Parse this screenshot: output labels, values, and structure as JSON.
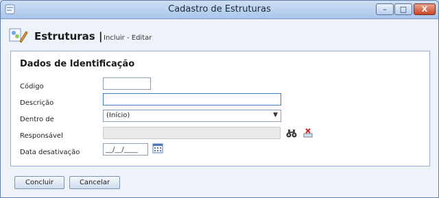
{
  "window": {
    "title": "Cadastro de Estruturas",
    "buttons": {
      "minimize": "–",
      "maximize": "□",
      "close": "X"
    }
  },
  "header": {
    "title": "Estruturas |",
    "subtitle": "Incluir - Editar",
    "icon": "structure-edit-icon"
  },
  "section": {
    "title": "Dados de Identificação"
  },
  "form": {
    "codigo": {
      "label": "Código",
      "value": ""
    },
    "descricao": {
      "label": "Descrição",
      "value": ""
    },
    "dentro_de": {
      "label": "Dentro de",
      "selected": "(Início)"
    },
    "responsavel": {
      "label": "Responsável",
      "value": ""
    },
    "data_desativacao": {
      "label": "Data desativação",
      "value": "__/__/____"
    }
  },
  "icons": {
    "search": "binoculars-icon",
    "clear": "clear-icon",
    "calendar": "calendar-icon"
  },
  "actions": {
    "concluir": "Concluir",
    "cancelar": "Cancelar"
  }
}
